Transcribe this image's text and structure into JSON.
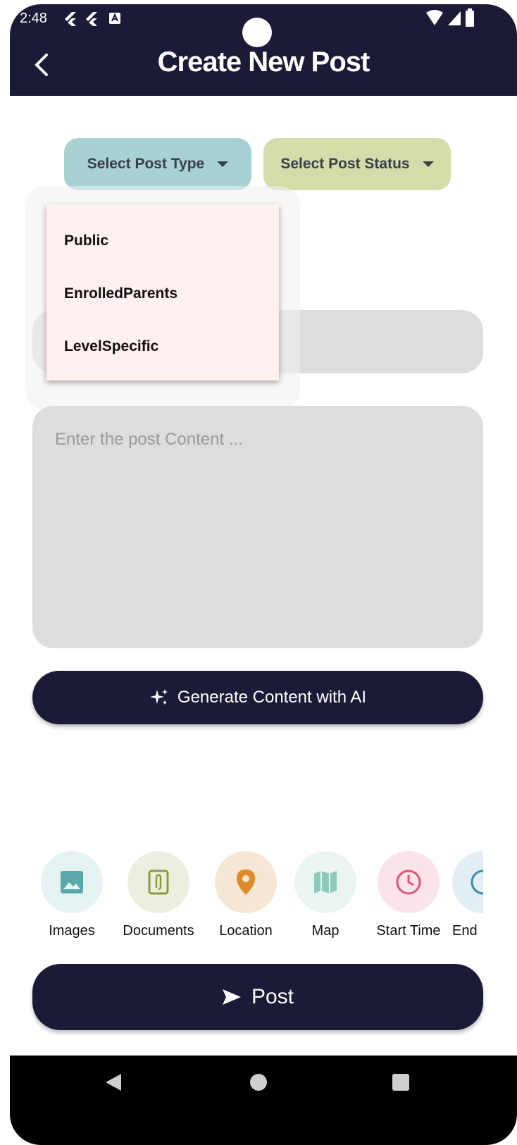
{
  "status_bar": {
    "time": "2:48"
  },
  "header": {
    "title": "Create New Post"
  },
  "selectors": {
    "post_type": "Select Post Type",
    "post_status": "Select Post Status"
  },
  "post_type_menu": {
    "items": [
      "Public",
      "EnrolledParents",
      "LevelSpecific"
    ]
  },
  "content": {
    "placeholder": "Enter the post Content ..."
  },
  "ai_button": {
    "label": "Generate Content with AI"
  },
  "attachments": [
    {
      "label": "Images",
      "icon": "image-icon",
      "bg": "#e6f2f2",
      "color": "#5aa8a8"
    },
    {
      "label": "Documents",
      "icon": "attachment-icon",
      "bg": "#ebefe0",
      "color": "#8c9a3a"
    },
    {
      "label": "Location",
      "icon": "location-pin-icon",
      "bg": "#f6e6d4",
      "color": "#e08a2a"
    },
    {
      "label": "Map",
      "icon": "map-icon",
      "bg": "#eaf4f2",
      "color": "#8cc9bb"
    },
    {
      "label": "Start Time",
      "icon": "clock-icon",
      "bg": "#fae4ea",
      "color": "#e0547a"
    },
    {
      "label": "End",
      "icon": "clock-icon",
      "bg": "#e2eef3",
      "color": "#3a8aa8"
    }
  ],
  "post_button": {
    "label": "Post"
  }
}
